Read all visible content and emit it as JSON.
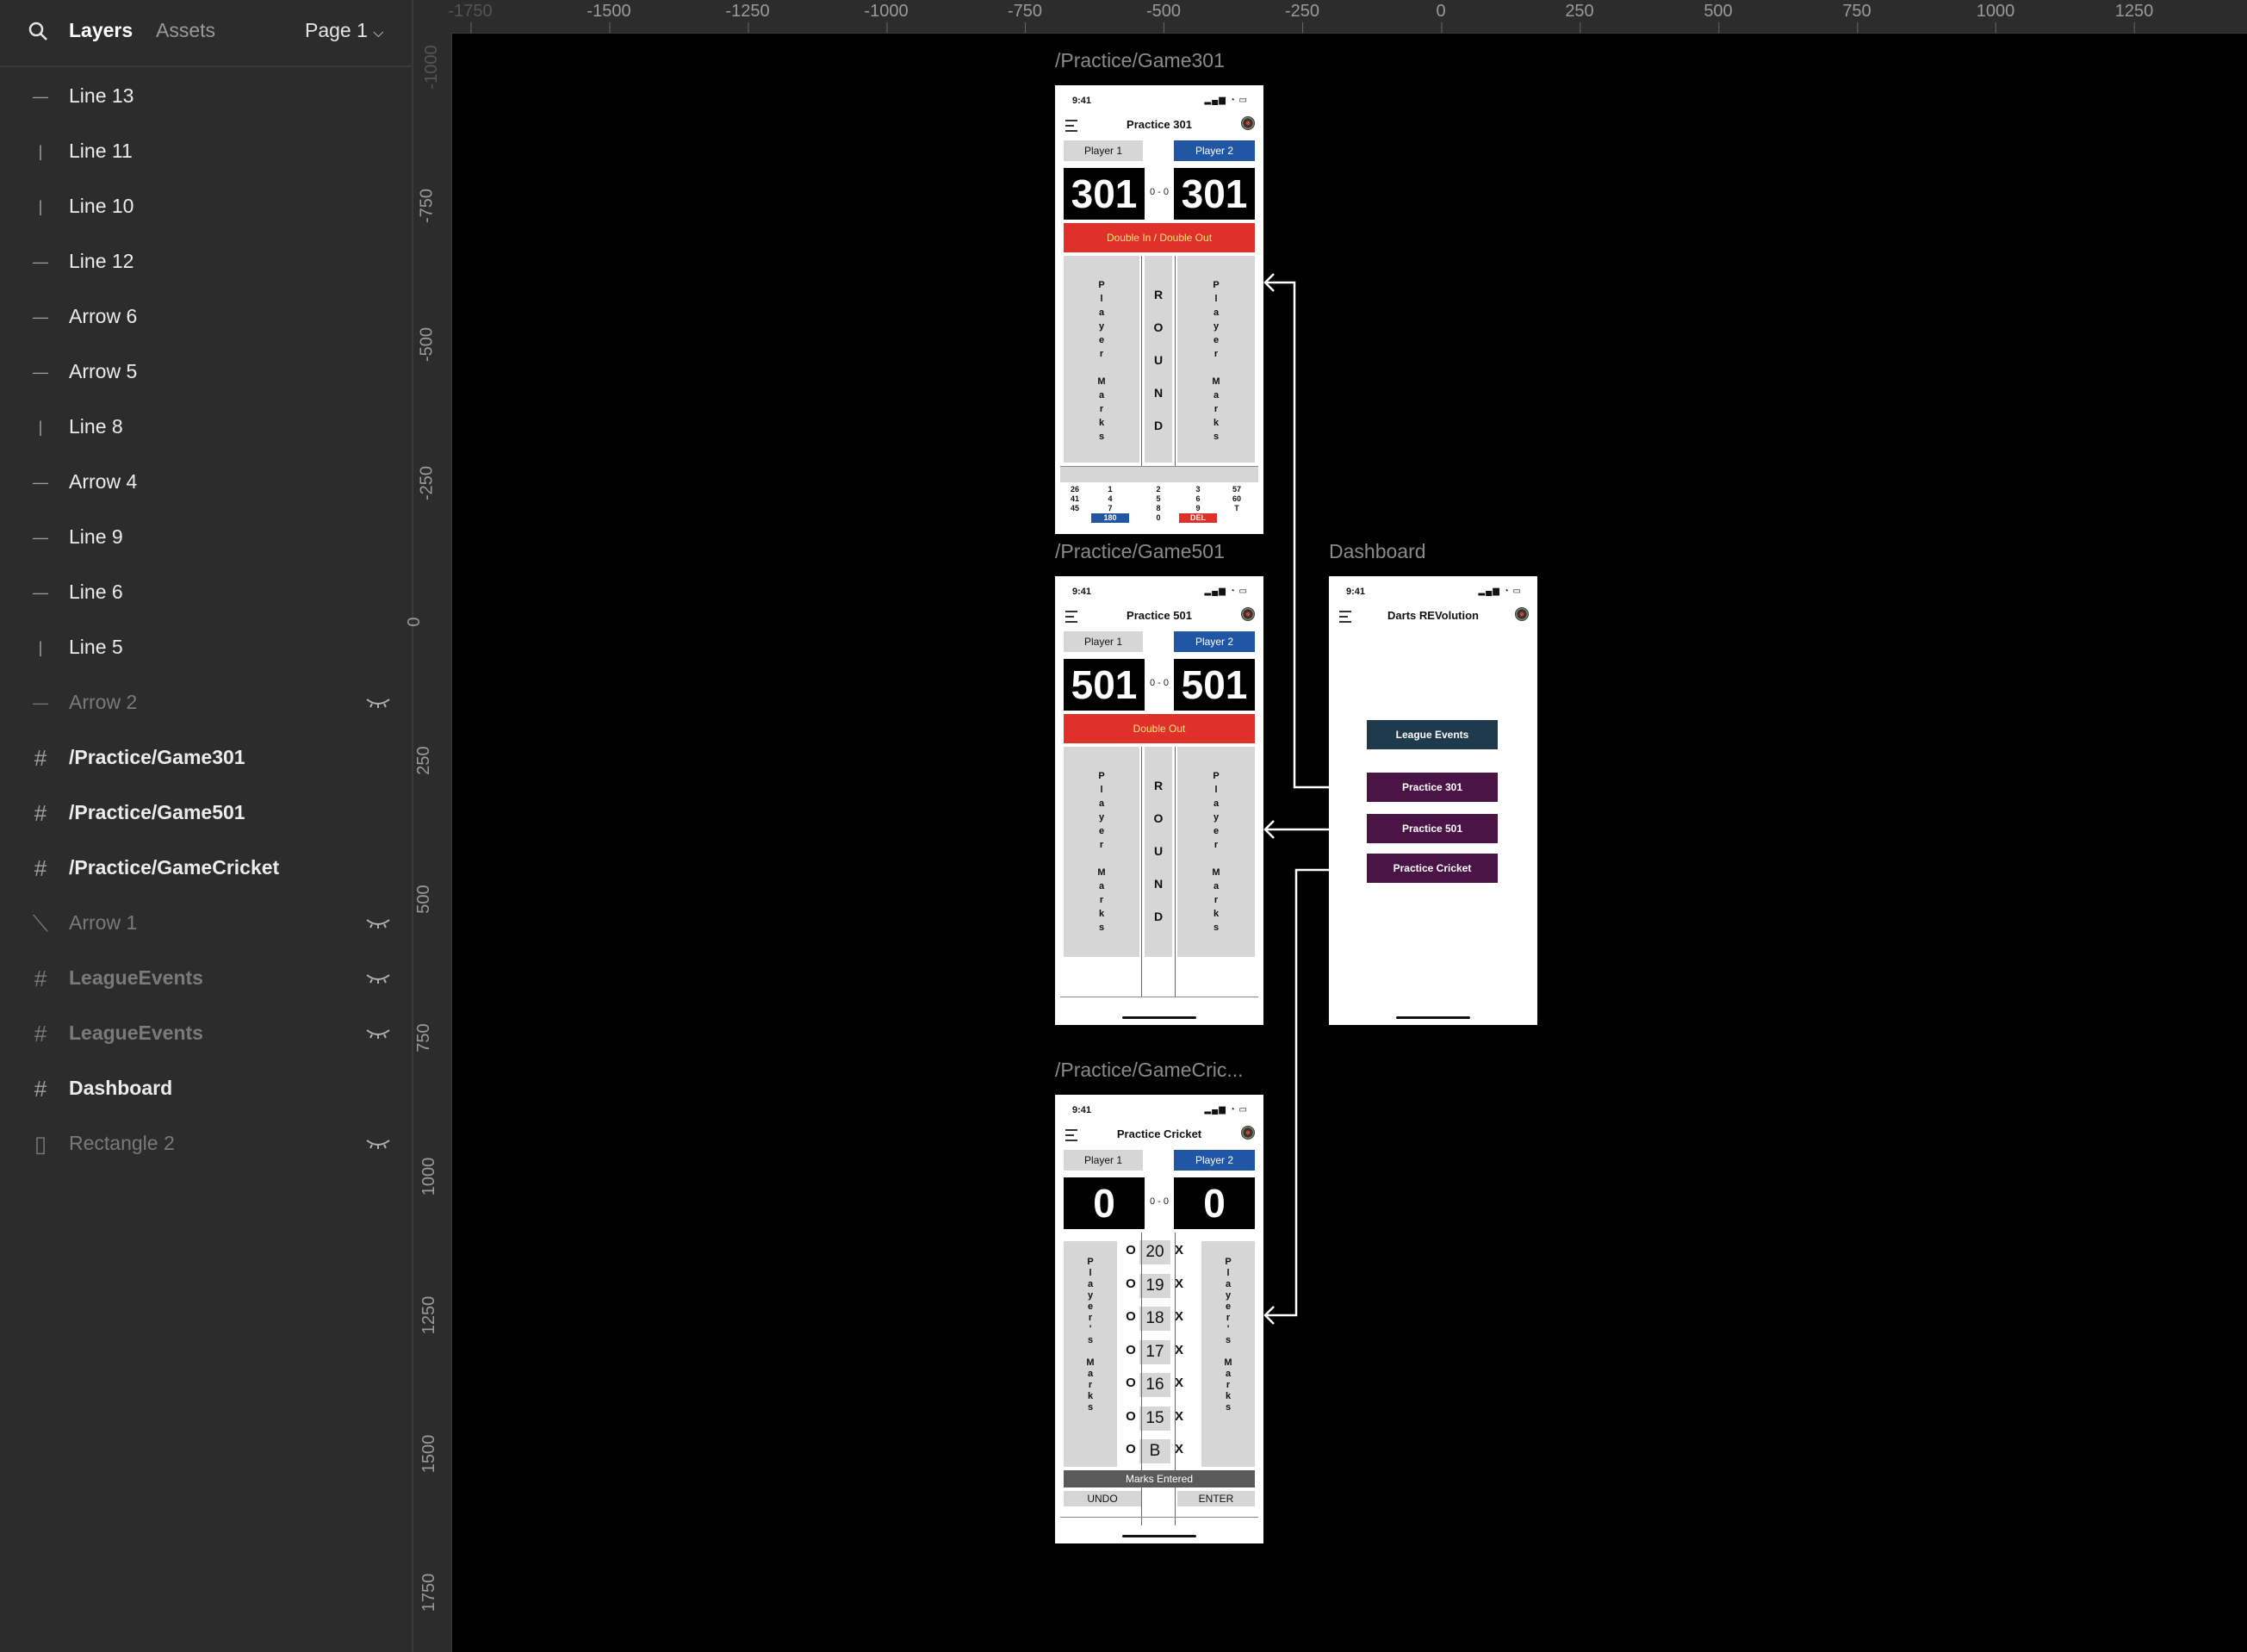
{
  "sidebar": {
    "tabs": {
      "layers": "Layers",
      "assets": "Assets"
    },
    "page_selector": "Page 1",
    "layers": [
      {
        "name": "Line 13",
        "icon": "line-horizontal-icon",
        "hidden": false,
        "frame": false
      },
      {
        "name": "Line 11",
        "icon": "line-vertical-icon",
        "hidden": false,
        "frame": false
      },
      {
        "name": "Line 10",
        "icon": "line-vertical-icon",
        "hidden": false,
        "frame": false
      },
      {
        "name": "Line 12",
        "icon": "line-horizontal-icon",
        "hidden": false,
        "frame": false
      },
      {
        "name": "Arrow 6",
        "icon": "line-horizontal-icon",
        "hidden": false,
        "frame": false
      },
      {
        "name": "Arrow 5",
        "icon": "line-horizontal-icon",
        "hidden": false,
        "frame": false
      },
      {
        "name": "Line 8",
        "icon": "line-vertical-icon",
        "hidden": false,
        "frame": false
      },
      {
        "name": "Arrow 4",
        "icon": "line-horizontal-icon",
        "hidden": false,
        "frame": false
      },
      {
        "name": "Line 9",
        "icon": "line-horizontal-icon",
        "hidden": false,
        "frame": false
      },
      {
        "name": "Line 6",
        "icon": "line-horizontal-icon",
        "hidden": false,
        "frame": false
      },
      {
        "name": "Line 5",
        "icon": "line-vertical-icon",
        "hidden": false,
        "frame": false
      },
      {
        "name": "Arrow 2",
        "icon": "line-horizontal-icon",
        "hidden": true,
        "frame": false
      },
      {
        "name": "/Practice/Game301",
        "icon": "frame-icon",
        "hidden": false,
        "frame": true
      },
      {
        "name": "/Practice/Game501",
        "icon": "frame-icon",
        "hidden": false,
        "frame": true
      },
      {
        "name": "/Practice/GameCricket",
        "icon": "frame-icon",
        "hidden": false,
        "frame": true
      },
      {
        "name": "Arrow 1",
        "icon": "line-diagonal-icon",
        "hidden": true,
        "frame": false
      },
      {
        "name": "LeagueEvents",
        "icon": "frame-icon",
        "hidden": true,
        "frame": true
      },
      {
        "name": "LeagueEvents",
        "icon": "frame-icon",
        "hidden": true,
        "frame": true
      },
      {
        "name": "Dashboard",
        "icon": "frame-icon",
        "hidden": false,
        "frame": true
      },
      {
        "name": "Rectangle 2",
        "icon": "rectangle-icon",
        "hidden": true,
        "frame": false
      }
    ]
  },
  "rulers": {
    "top": [
      "-1750",
      "-1500",
      "-1250",
      "-1000",
      "-750",
      "-500",
      "-250",
      "0",
      "250",
      "500",
      "750",
      "1000",
      "1250"
    ],
    "left": [
      "-1000",
      "-750",
      "-500",
      "-250",
      "0",
      "250",
      "500",
      "750",
      "1000",
      "1250",
      "1500",
      "1750"
    ]
  },
  "canvas": {
    "frames": {
      "game301": "/Practice/Game301",
      "game501": "/Practice/Game501",
      "cricket": "/Practice/GameCric...",
      "dashboard": "Dashboard"
    },
    "status_time": "9:41",
    "game301": {
      "title": "Practice 301",
      "player1": "Player 1",
      "player2": "Player 2",
      "score1": "301",
      "score2": "301",
      "legs": "0 - 0",
      "rule": "Double In / Double Out",
      "marks_text": "Player Marks",
      "round_text": "ROUND",
      "keypad": {
        "col1": [
          "26",
          "41",
          "45"
        ],
        "col2": [
          "1",
          "4",
          "7",
          "180"
        ],
        "col3": [
          "2",
          "5",
          "8",
          "0"
        ],
        "col4": [
          "3",
          "6",
          "9",
          "DEL"
        ],
        "col5": [
          "57",
          "60",
          "T"
        ]
      }
    },
    "game501": {
      "title": "Practice 501",
      "player1": "Player 1",
      "player2": "Player 2",
      "score1": "501",
      "score2": "501",
      "legs": "0 - 0",
      "rule": "Double Out",
      "marks_text": "Player Marks",
      "round_text": "ROUND"
    },
    "cricket": {
      "title": "Practice Cricket",
      "player1": "Player 1",
      "player2": "Player 2",
      "score1": "0",
      "score2": "0",
      "legs": "0 - 0",
      "marks_text": "Player's Marks",
      "numbers": [
        "20",
        "19",
        "18",
        "17",
        "16",
        "15",
        "B"
      ],
      "o_mark": "O",
      "x_mark": "X",
      "marks_entered": "Marks Entered",
      "undo": "UNDO",
      "enter": "ENTER"
    },
    "dashboard": {
      "title": "Darts REVolution",
      "buttons": [
        "League Events",
        "Practice 301",
        "Practice 501",
        "Practice Cricket"
      ],
      "colors": {
        "league": "#1f3a4d",
        "practice": "#4a1546"
      }
    }
  },
  "colors": {
    "accent_blue": "#2156a5",
    "accent_red": "#e0302a",
    "sidebar_bg": "#2c2c2c"
  }
}
